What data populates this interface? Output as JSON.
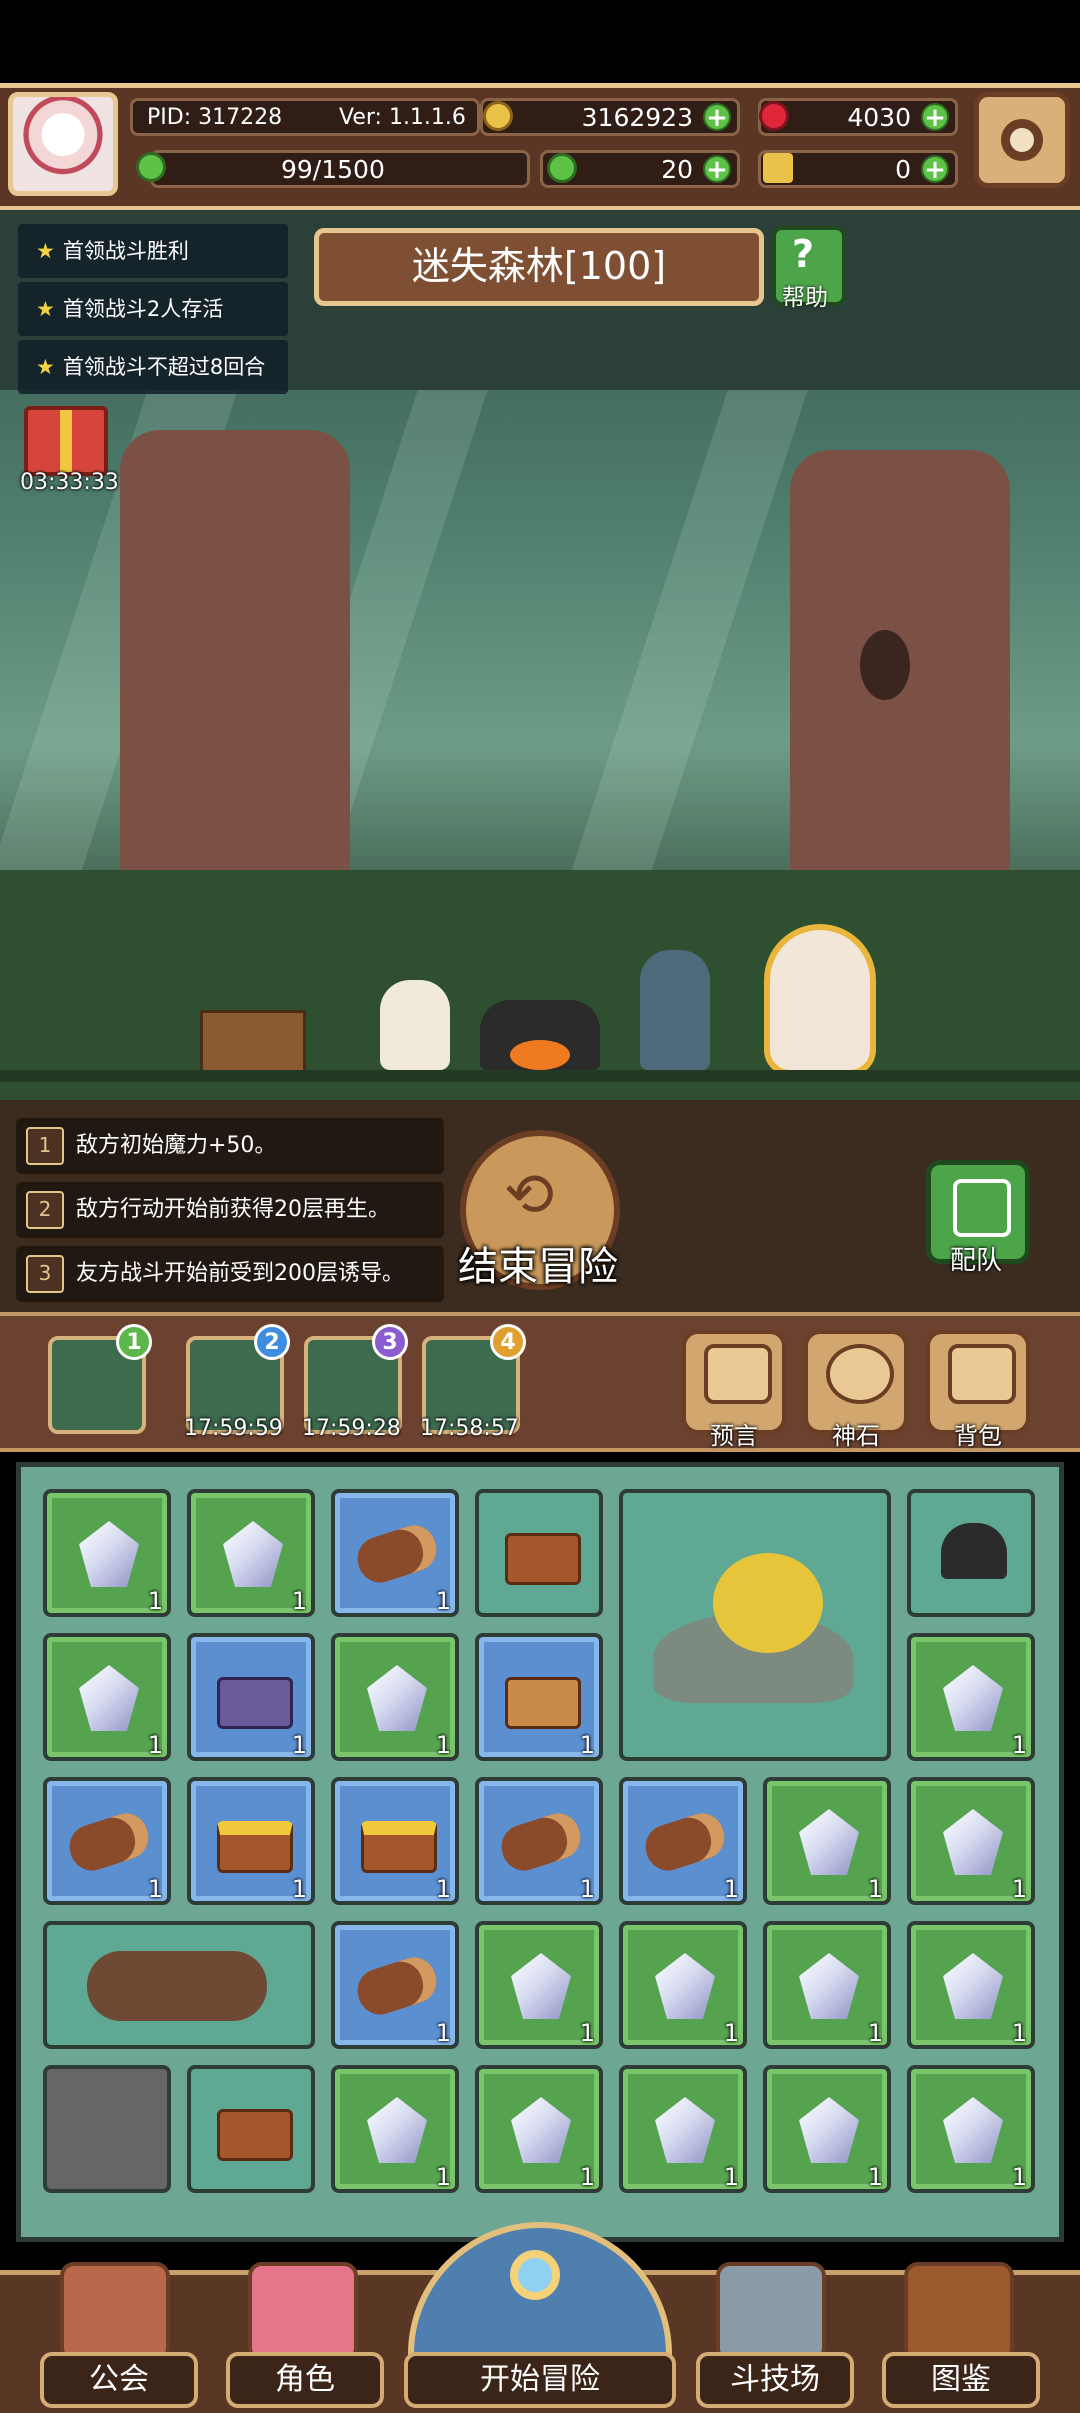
{
  "header": {
    "pid": "PID: 317228",
    "version": "Ver: 1.1.1.6",
    "gold": "3162923",
    "gems": "4030",
    "stamina": "99/1500",
    "clover": "20",
    "key": "0"
  },
  "missions": [
    "首领战斗胜利",
    "首领战斗2人存活",
    "首领战斗不超过8回合"
  ],
  "gift_timer": "03:33:33",
  "stage": {
    "title": "迷失森林[100]",
    "help_label": "帮助"
  },
  "effects": [
    {
      "num": "1",
      "text": "敌方初始魔力+50。"
    },
    {
      "num": "2",
      "text": "敌方行动开始前获得20层再生。"
    },
    {
      "num": "3",
      "text": "友方战斗开始前受到200层诱导。"
    }
  ],
  "end_adventure_label": "结束冒险",
  "team_label": "配队",
  "slots": [
    {
      "num": "1",
      "color": "#5cb74a",
      "time": ""
    },
    {
      "num": "2",
      "color": "#3d8ee0",
      "time": "17:59:59"
    },
    {
      "num": "3",
      "color": "#8b5bd0",
      "time": "17:59:28"
    },
    {
      "num": "4",
      "color": "#e0a030",
      "time": "17:58:57"
    }
  ],
  "tools": [
    {
      "label": "预言",
      "icon": "crystal-ball-icon"
    },
    {
      "label": "神石",
      "icon": "stone-icon"
    },
    {
      "label": "背包",
      "icon": "backpack-icon"
    }
  ],
  "inventory_qty": "1",
  "nav": [
    {
      "label": "公会",
      "icon": "guild-icon"
    },
    {
      "label": "角色",
      "icon": "character-icon"
    },
    {
      "label": "开始冒险",
      "icon": "magnifier-map-icon"
    },
    {
      "label": "斗技场",
      "icon": "crossed-swords-icon"
    },
    {
      "label": "图鉴",
      "icon": "book-icon"
    }
  ],
  "colors": {
    "accent": "#e6c58f",
    "panel": "#5b3624",
    "plus": "#5ec246"
  }
}
